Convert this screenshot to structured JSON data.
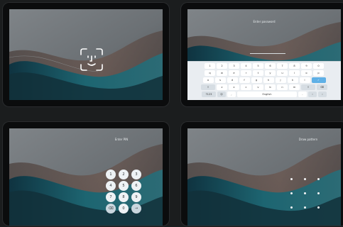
{
  "screens": {
    "face": {
      "icon": "face-unlock-icon"
    },
    "password": {
      "prompt": "Enter password",
      "keyboard": {
        "row_numbers": [
          "1",
          "2",
          "3",
          "4",
          "5",
          "6",
          "7",
          "8",
          "9",
          "0"
        ],
        "row_top": [
          "q",
          "w",
          "e",
          "r",
          "t",
          "y",
          "u",
          "i",
          "o",
          "p"
        ],
        "row_mid": [
          "a",
          "s",
          "d",
          "f",
          "g",
          "h",
          "j",
          "k",
          "l"
        ],
        "row_bottom": [
          "z",
          "x",
          "c",
          "v",
          "b",
          "n",
          "m"
        ],
        "shift": "⇧",
        "backspace": "⌫",
        "enter": "✓",
        "symbols": "?123",
        "emoji": "☺",
        "comma": ",",
        "space": "English",
        "period": ".",
        "arrow_left": "‹",
        "arrow_right": "›"
      }
    },
    "pin": {
      "prompt": "Enter PIN",
      "keys": [
        "1",
        "2",
        "3",
        "4",
        "5",
        "6",
        "7",
        "8",
        "9",
        "⌫",
        "0",
        "→"
      ]
    },
    "pattern": {
      "prompt": "Draw pattern"
    }
  },
  "colors": {
    "accent": "#5fb0e6",
    "wall_light": "#7a7f84",
    "wall_teal": "#1f6c78",
    "wall_dark": "#122a33"
  }
}
